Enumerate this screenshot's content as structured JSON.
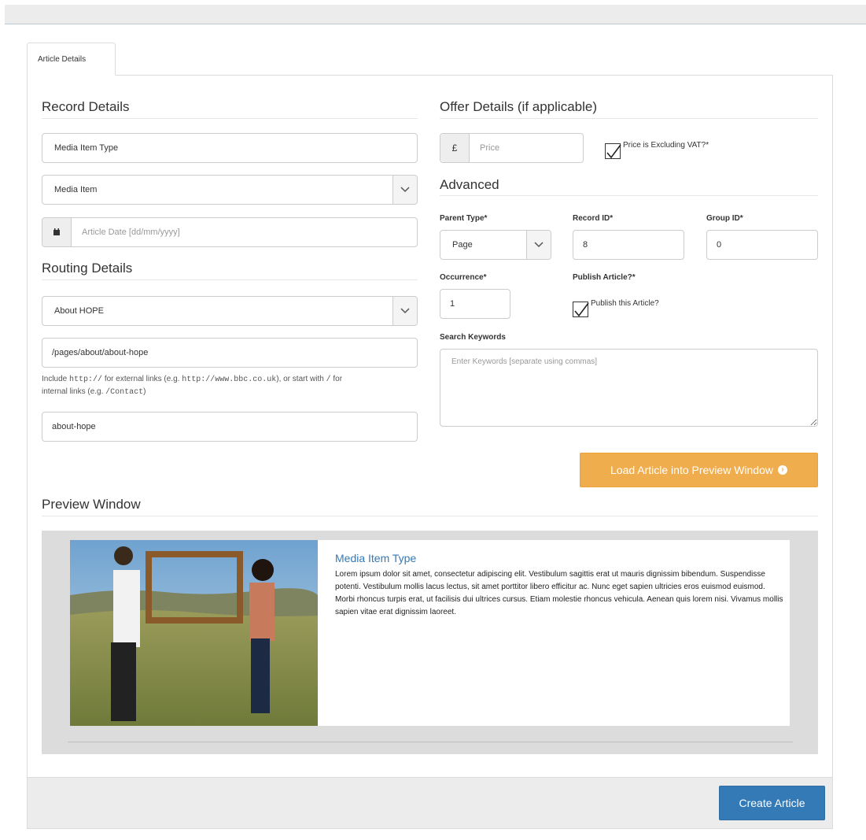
{
  "tab": {
    "label": "Article Details"
  },
  "record": {
    "heading": "Record Details",
    "media_item_type_value": "Media Item Type",
    "media_select_value": "Media Item",
    "date_placeholder": "Article Date [dd/mm/yyyy]"
  },
  "routing": {
    "heading": "Routing Details",
    "page_select_value": "About HOPE",
    "url_value": "/pages/about/about-hope",
    "help_include": "Include ",
    "help_http": "http://",
    "help_mid": " for external links (e.g. ",
    "help_example": "http://www.bbc.co.uk",
    "help_after": "), or start with ",
    "help_slash": "/",
    "help_for": " for",
    "help_internal": "internal links (e.g. ",
    "help_contact": "/Contact",
    "help_end": ")",
    "slug_value": "about-hope"
  },
  "offer": {
    "heading": "Offer Details (if applicable)",
    "currency_symbol": "£",
    "price_placeholder": "Price",
    "vat_label": "Price is Excluding VAT?*",
    "vat_checked": true
  },
  "advanced": {
    "heading": "Advanced",
    "parent_type_label": "Parent Type*",
    "parent_type_value": "Page",
    "record_id_label": "Record ID*",
    "record_id_value": "8",
    "group_id_label": "Group ID*",
    "group_id_value": "0",
    "occurrence_label": "Occurrence*",
    "occurrence_value": "1",
    "publish_label": "Publish Article?*",
    "publish_checkbox_label": "Publish this Article?",
    "publish_checked": true,
    "keywords_label": "Search Keywords",
    "keywords_placeholder": "Enter Keywords [separate using commas]"
  },
  "load_button": {
    "label": "Load Article into Preview Window"
  },
  "preview": {
    "heading": "Preview Window",
    "title": "Media Item Type",
    "body": "Lorem ipsum dolor sit amet, consectetur adipiscing elit. Vestibulum sagittis erat ut mauris dignissim bibendum. Suspendisse potenti. Vestibulum mollis lacus lectus, sit amet porttitor libero efficitur ac. Nunc eget sapien ultricies eros euismod euismod. Morbi rhoncus turpis erat, ut facilisis dui ultrices cursus. Etiam molestie rhoncus vehicula. Aenean quis lorem nisi. Vivamus mollis sapien vitae erat dignissim laoreet."
  },
  "footer": {
    "create_label": "Create Article"
  }
}
